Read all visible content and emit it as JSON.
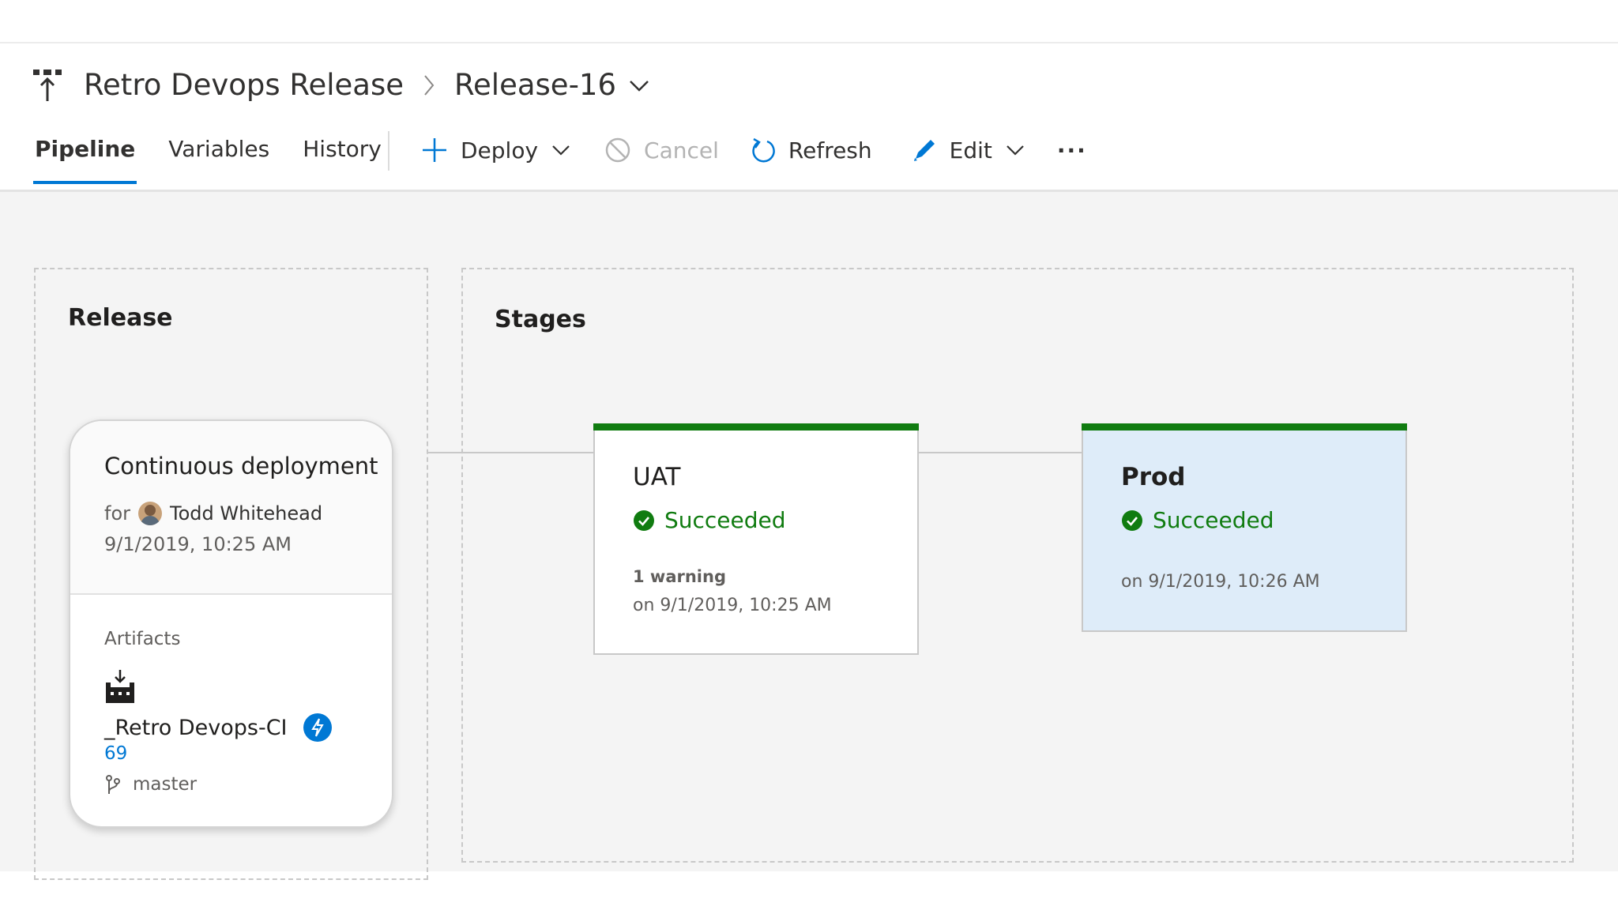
{
  "header": {
    "pipeline_name": "Retro Devops Release",
    "release_name": "Release-16"
  },
  "tabs": [
    {
      "label": "Pipeline",
      "active": true
    },
    {
      "label": "Variables",
      "active": false
    },
    {
      "label": "History",
      "active": false
    }
  ],
  "toolbar": {
    "deploy": "Deploy",
    "cancel": "Cancel",
    "refresh": "Refresh",
    "edit": "Edit",
    "more": "···"
  },
  "release_panel": {
    "title": "Release",
    "card": {
      "title": "Continuous deployment",
      "for_label": "for",
      "user": "Todd Whitehead",
      "date": "9/1/2019, 10:25 AM",
      "artifacts_label": "Artifacts",
      "artifact_name": "_Retro Devops-CI",
      "build_number": "69",
      "branch": "master"
    }
  },
  "stages_panel": {
    "title": "Stages",
    "stages": [
      {
        "name": "UAT",
        "status": "Succeeded",
        "warning": "1 warning",
        "date": "on 9/1/2019, 10:25 AM"
      },
      {
        "name": "Prod",
        "status": "Succeeded",
        "date": "on 9/1/2019, 10:26 AM"
      }
    ]
  },
  "colors": {
    "accent": "#0078d4",
    "success": "#107c10",
    "selected_stage_bg": "#deecf9"
  }
}
